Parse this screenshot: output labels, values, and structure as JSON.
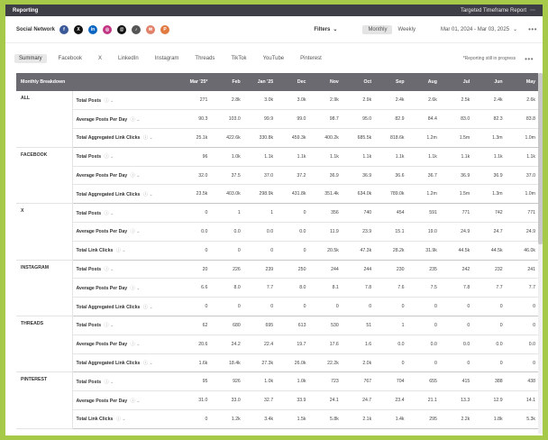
{
  "topbar": {
    "title": "Reporting",
    "report_menu": "Targeted Timeframe Report"
  },
  "nav": {
    "social_network_label": "Social Network",
    "networks": [
      {
        "icon": "facebook-icon",
        "glyph": "f",
        "color": "#3b5998"
      },
      {
        "icon": "x-icon",
        "glyph": "X",
        "color": "#111111"
      },
      {
        "icon": "linkedin-icon",
        "glyph": "in",
        "color": "#0a66c2"
      },
      {
        "icon": "instagram-icon",
        "glyph": "◎",
        "color": "#c13584"
      },
      {
        "icon": "threads-icon",
        "glyph": "@",
        "color": "#111111"
      },
      {
        "icon": "tiktok-icon",
        "glyph": "♪",
        "color": "#555555"
      },
      {
        "icon": "email-icon",
        "glyph": "✉",
        "color": "#e0826a"
      },
      {
        "icon": "pinterest-icon",
        "glyph": "P",
        "color": "#e07a40"
      }
    ],
    "filters_label": "Filters",
    "monthly_label": "Monthly",
    "weekly_label": "Weekly",
    "date_range": "Mar 01, 2024 - Mar 03, 2025"
  },
  "tabs": [
    "Summary",
    "Facebook",
    "X",
    "LinkedIn",
    "Instagram",
    "Threads",
    "TikTok",
    "YouTube",
    "Pinterest"
  ],
  "note": "*Reporting still in progress",
  "table": {
    "header_label": "Monthly Breakdown",
    "months": [
      "Mar '25*",
      "Feb",
      "Jan '25",
      "Dec",
      "Nov",
      "Oct",
      "Sep",
      "Aug",
      "Jul",
      "Jun",
      "May"
    ],
    "groups": [
      {
        "network": "ALL",
        "rows": [
          {
            "metric": "Total Posts",
            "values": [
              "271",
              "2.8k",
              "3.0k",
              "3.0k",
              "2.9k",
              "2.9k",
              "2.4k",
              "2.6k",
              "2.5k",
              "2.4k",
              "2.6k"
            ]
          },
          {
            "metric": "Average Posts Per Day",
            "values": [
              "90.3",
              "103.0",
              "99.9",
              "99.0",
              "98.7",
              "95.0",
              "82.9",
              "84.4",
              "83.0",
              "82.3",
              "83.8"
            ]
          },
          {
            "metric": "Total Aggregated Link Clicks",
            "values": [
              "25.1k",
              "422.6k",
              "330.8k",
              "459.3k",
              "400.2k",
              "685.5k",
              "818.6k",
              "1.2m",
              "1.5m",
              "1.3m",
              "1.0m"
            ]
          }
        ]
      },
      {
        "network": "FACEBOOK",
        "rows": [
          {
            "metric": "Total Posts",
            "values": [
              "96",
              "1.0k",
              "1.1k",
              "1.1k",
              "1.1k",
              "1.1k",
              "1.1k",
              "1.1k",
              "1.1k",
              "1.1k",
              "1.1k"
            ]
          },
          {
            "metric": "Average Posts Per Day",
            "values": [
              "32.0",
              "37.5",
              "37.0",
              "37.2",
              "36.9",
              "36.9",
              "36.6",
              "36.7",
              "36.9",
              "36.9",
              "37.0"
            ]
          },
          {
            "metric": "Total Aggregated Link Clicks",
            "values": [
              "23.5k",
              "403.0k",
              "298.9k",
              "431.8k",
              "351.4k",
              "634.0k",
              "789.0k",
              "1.2m",
              "1.5m",
              "1.3m",
              "1.0m"
            ]
          }
        ]
      },
      {
        "network": "X",
        "rows": [
          {
            "metric": "Total Posts",
            "values": [
              "0",
              "1",
              "1",
              "0",
              "356",
              "740",
              "454",
              "591",
              "771",
              "742",
              "771"
            ]
          },
          {
            "metric": "Average Posts Per Day",
            "values": [
              "0.0",
              "0.0",
              "0.0",
              "0.0",
              "11.9",
              "23.9",
              "15.1",
              "19.0",
              "24.9",
              "24.7",
              "24.9"
            ]
          },
          {
            "metric": "Total Link Clicks",
            "values": [
              "0",
              "0",
              "0",
              "0",
              "20.5k",
              "47.3k",
              "28.2k",
              "31.9k",
              "44.5k",
              "44.5k",
              "46.0k"
            ]
          }
        ]
      },
      {
        "network": "INSTAGRAM",
        "rows": [
          {
            "metric": "Total Posts",
            "values": [
              "20",
              "226",
              "239",
              "250",
              "244",
              "244",
              "230",
              "235",
              "242",
              "232",
              "241"
            ]
          },
          {
            "metric": "Average Posts Per Day",
            "values": [
              "6.6",
              "8.0",
              "7.7",
              "8.0",
              "8.1",
              "7.8",
              "7.6",
              "7.5",
              "7.8",
              "7.7",
              "7.7"
            ]
          },
          {
            "metric": "Total Aggregated Link Clicks",
            "values": [
              "0",
              "0",
              "0",
              "0",
              "0",
              "0",
              "0",
              "0",
              "0",
              "0",
              "0"
            ]
          }
        ]
      },
      {
        "network": "THREADS",
        "rows": [
          {
            "metric": "Total Posts",
            "values": [
              "62",
              "680",
              "695",
              "613",
              "530",
              "51",
              "1",
              "0",
              "0",
              "0",
              "0"
            ]
          },
          {
            "metric": "Average Posts Per Day",
            "values": [
              "20.6",
              "24.2",
              "22.4",
              "19.7",
              "17.6",
              "1.6",
              "0.0",
              "0.0",
              "0.0",
              "0.0",
              "0.0"
            ]
          },
          {
            "metric": "Total Aggregated Link Clicks",
            "values": [
              "1.6k",
              "18.4k",
              "27.3k",
              "26.0k",
              "22.2k",
              "2.0k",
              "0",
              "0",
              "0",
              "0",
              "0"
            ]
          }
        ]
      },
      {
        "network": "PINTEREST",
        "rows": [
          {
            "metric": "Total Posts",
            "values": [
              "95",
              "926",
              "1.0k",
              "1.0k",
              "723",
              "767",
              "704",
              "655",
              "415",
              "388",
              "438"
            ]
          },
          {
            "metric": "Average Posts Per Day",
            "values": [
              "31.0",
              "33.0",
              "32.7",
              "33.9",
              "24.1",
              "24.7",
              "23.4",
              "21.1",
              "13.3",
              "12.9",
              "14.1"
            ]
          },
          {
            "metric": "Total Link Clicks",
            "values": [
              "0",
              "1.2k",
              "3.4k",
              "1.5k",
              "5.8k",
              "2.1k",
              "1.4k",
              "295",
              "2.2k",
              "1.8k",
              "5.3k"
            ]
          }
        ]
      }
    ]
  }
}
